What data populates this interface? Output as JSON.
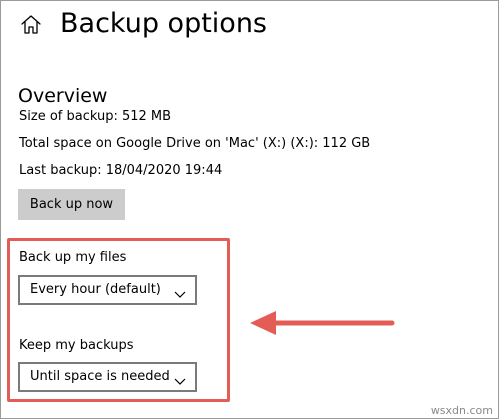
{
  "header": {
    "home_icon": "home-icon",
    "title": "Backup options"
  },
  "overview": {
    "title": "Overview",
    "size_of_backup": "Size of backup: 512 MB",
    "total_space": "Total space on Google Drive on 'Mac' (X:) (X:): 112 GB",
    "last_backup": "Last backup: 18/04/2020 19:44",
    "backup_button_label": "Back up now"
  },
  "settings": {
    "backup_frequency": {
      "label": "Back up my files",
      "selected": "Every hour (default)"
    },
    "keep_backups": {
      "label": "Keep my backups",
      "selected": "Until space is needed"
    }
  },
  "annotation": {
    "highlight_color": "#e35d56",
    "arrow_color": "#e35d56",
    "arrow_direction": "left"
  },
  "watermark": "wsxdn.com"
}
